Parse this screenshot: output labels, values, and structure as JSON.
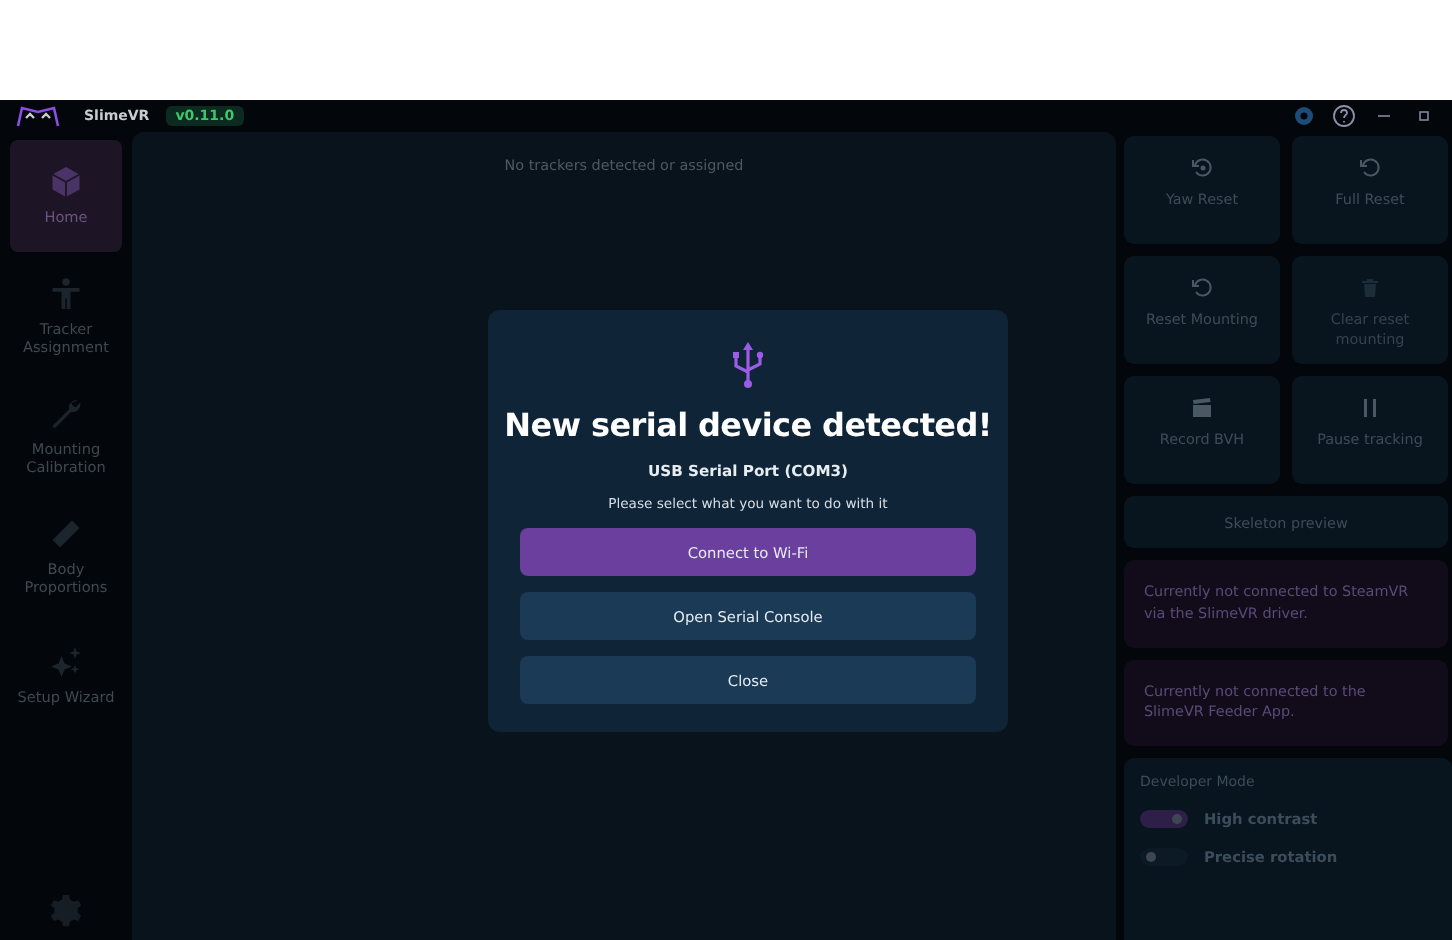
{
  "window": {
    "app_name": "SlimeVR",
    "version": "v0.11.0"
  },
  "sidebar": {
    "items": [
      {
        "label": "Home",
        "selected": true
      },
      {
        "label": "Tracker Assignment",
        "selected": false
      },
      {
        "label": "Mounting Calibration",
        "selected": false
      },
      {
        "label": "Body Proportions",
        "selected": false
      },
      {
        "label": "Setup Wizard",
        "selected": false
      }
    ]
  },
  "main": {
    "empty_message": "No trackers detected or assigned"
  },
  "actions": [
    {
      "label": "Yaw Reset",
      "disabled": false
    },
    {
      "label": "Full Reset",
      "disabled": false
    },
    {
      "label": "Reset Mounting",
      "disabled": false
    },
    {
      "label": "Clear reset mounting",
      "disabled": true
    },
    {
      "label": "Record BVH",
      "disabled": false
    },
    {
      "label": "Pause tracking",
      "disabled": false
    }
  ],
  "skeleton_button": "Skeleton preview",
  "status_cards": [
    "Currently not connected to SteamVR via the SlimeVR driver.",
    "Currently not connected to the SlimeVR Feeder App."
  ],
  "developer_mode": {
    "title": "Developer Mode",
    "toggles": [
      {
        "label": "High contrast",
        "on": true
      },
      {
        "label": "Precise rotation",
        "on": false
      }
    ]
  },
  "dialog": {
    "title": "New serial device detected!",
    "device": "USB Serial Port (COM3)",
    "prompt": "Please select what you want to do with it",
    "buttons": [
      {
        "label": "Connect to Wi-Fi",
        "kind": "primary"
      },
      {
        "label": "Open Serial Console",
        "kind": "secondary"
      },
      {
        "label": "Close",
        "kind": "secondary"
      }
    ]
  }
}
